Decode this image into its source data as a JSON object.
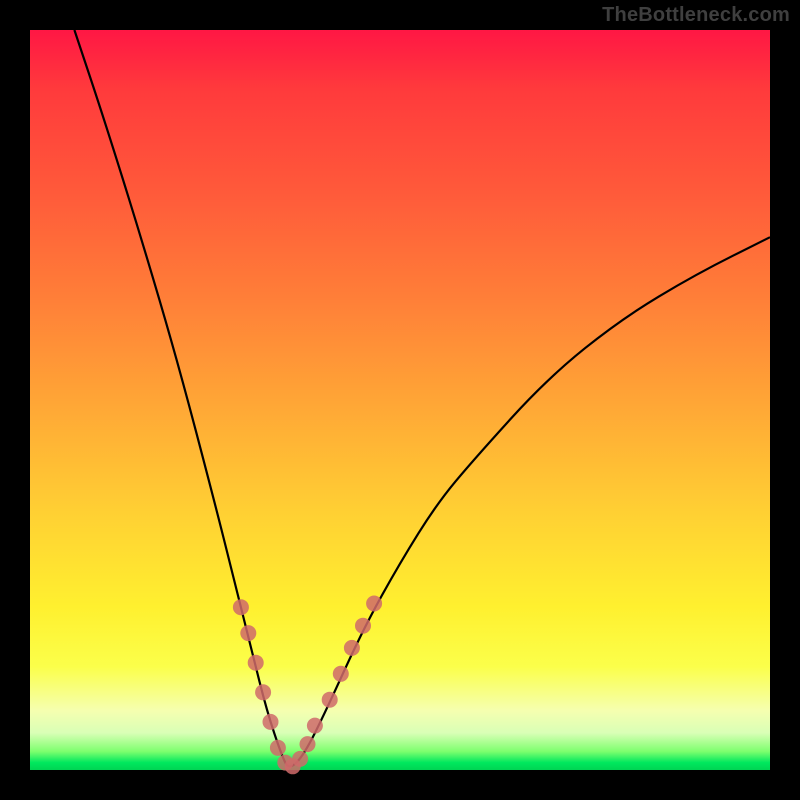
{
  "watermark": "TheBottleneck.com",
  "chart_data": {
    "type": "line",
    "title": "",
    "xlabel": "",
    "ylabel": "",
    "xlim": [
      0,
      100
    ],
    "ylim": [
      0,
      100
    ],
    "series": [
      {
        "name": "bottleneck-curve",
        "x": [
          6,
          10,
          15,
          20,
          25,
          28,
          30,
          32,
          34,
          35,
          37,
          40,
          45,
          50,
          55,
          60,
          70,
          80,
          90,
          100
        ],
        "values": [
          100,
          88,
          72,
          55,
          36,
          24,
          16,
          8,
          2,
          0,
          2,
          8,
          19,
          28,
          36,
          42,
          53,
          61,
          67,
          72
        ]
      }
    ],
    "markers": {
      "name": "sample-dots",
      "x": [
        28.5,
        29.5,
        30.5,
        31.5,
        32.5,
        33.5,
        34.5,
        35.5,
        36.5,
        37.5,
        38.5,
        40.5,
        42.0,
        43.5,
        45.0,
        46.5
      ],
      "values": [
        22.0,
        18.5,
        14.5,
        10.5,
        6.5,
        3.0,
        1.0,
        0.5,
        1.5,
        3.5,
        6.0,
        9.5,
        13.0,
        16.5,
        19.5,
        22.5
      ]
    },
    "gradient_stops": [
      {
        "pos": 0.0,
        "color": "#ff1744"
      },
      {
        "pos": 0.22,
        "color": "#ff5a3a"
      },
      {
        "pos": 0.5,
        "color": "#ffa536"
      },
      {
        "pos": 0.78,
        "color": "#fff02f"
      },
      {
        "pos": 0.92,
        "color": "#f5ffb0"
      },
      {
        "pos": 0.98,
        "color": "#39e86a"
      },
      {
        "pos": 1.0,
        "color": "#00d453"
      }
    ],
    "colors": {
      "curve": "#000000",
      "marker": "#cf6a6a",
      "frame": "#000000"
    }
  }
}
